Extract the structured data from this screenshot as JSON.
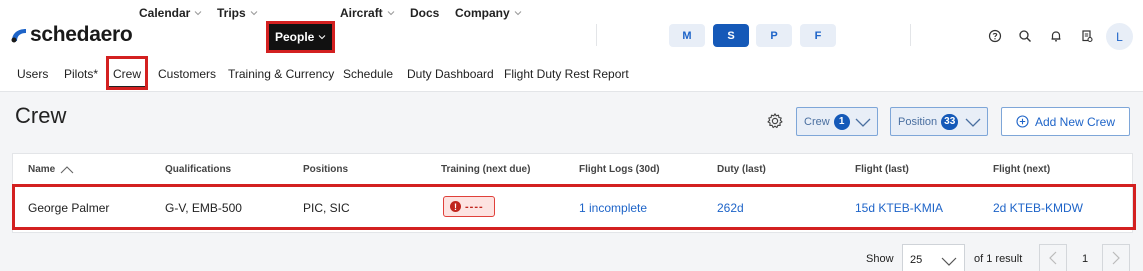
{
  "app": {
    "logo_text": "schedaero"
  },
  "nav": {
    "calendar": "Calendar",
    "trips": "Trips",
    "people": "People",
    "aircraft": "Aircraft",
    "docs": "Docs",
    "company": "Company"
  },
  "modes": [
    "M",
    "S",
    "P",
    "F"
  ],
  "active_mode": "S",
  "toolbar_icons": [
    "help-icon",
    "search-icon",
    "bell-icon",
    "report-icon"
  ],
  "avatar": "L",
  "subnav": {
    "users": "Users",
    "pilots": "Pilots*",
    "crew": "Crew",
    "customers": "Customers",
    "training": "Training & Currency",
    "schedule": "Schedule",
    "duty_dashboard": "Duty Dashboard",
    "fdr_report": "Flight Duty Rest Report"
  },
  "page": {
    "title": "Crew"
  },
  "filters": {
    "crew_label": "Crew",
    "crew_count": "1",
    "position_label": "Position",
    "position_count": "33"
  },
  "add_button": "Add New Crew",
  "table": {
    "columns": [
      "Name",
      "Qualifications",
      "Positions",
      "Training (next due)",
      "Flight Logs (30d)",
      "Duty (last)",
      "Flight (last)",
      "Flight (next)"
    ],
    "rows": [
      {
        "name": "George Palmer",
        "qualifications": "G-V, EMB-500",
        "positions": "PIC, SIC",
        "training": "----",
        "flight_logs": "1 incomplete",
        "duty": "262d",
        "flight_last": "15d KTEB-KMIA",
        "flight_next": "2d KTEB-KMDW"
      }
    ]
  },
  "pager": {
    "show_label": "Show",
    "page_size": "25",
    "result_text": "of 1 result",
    "page": "1"
  },
  "colors": {
    "accent": "#1559b8",
    "highlight": "#d32020",
    "link": "#1e64c8"
  }
}
